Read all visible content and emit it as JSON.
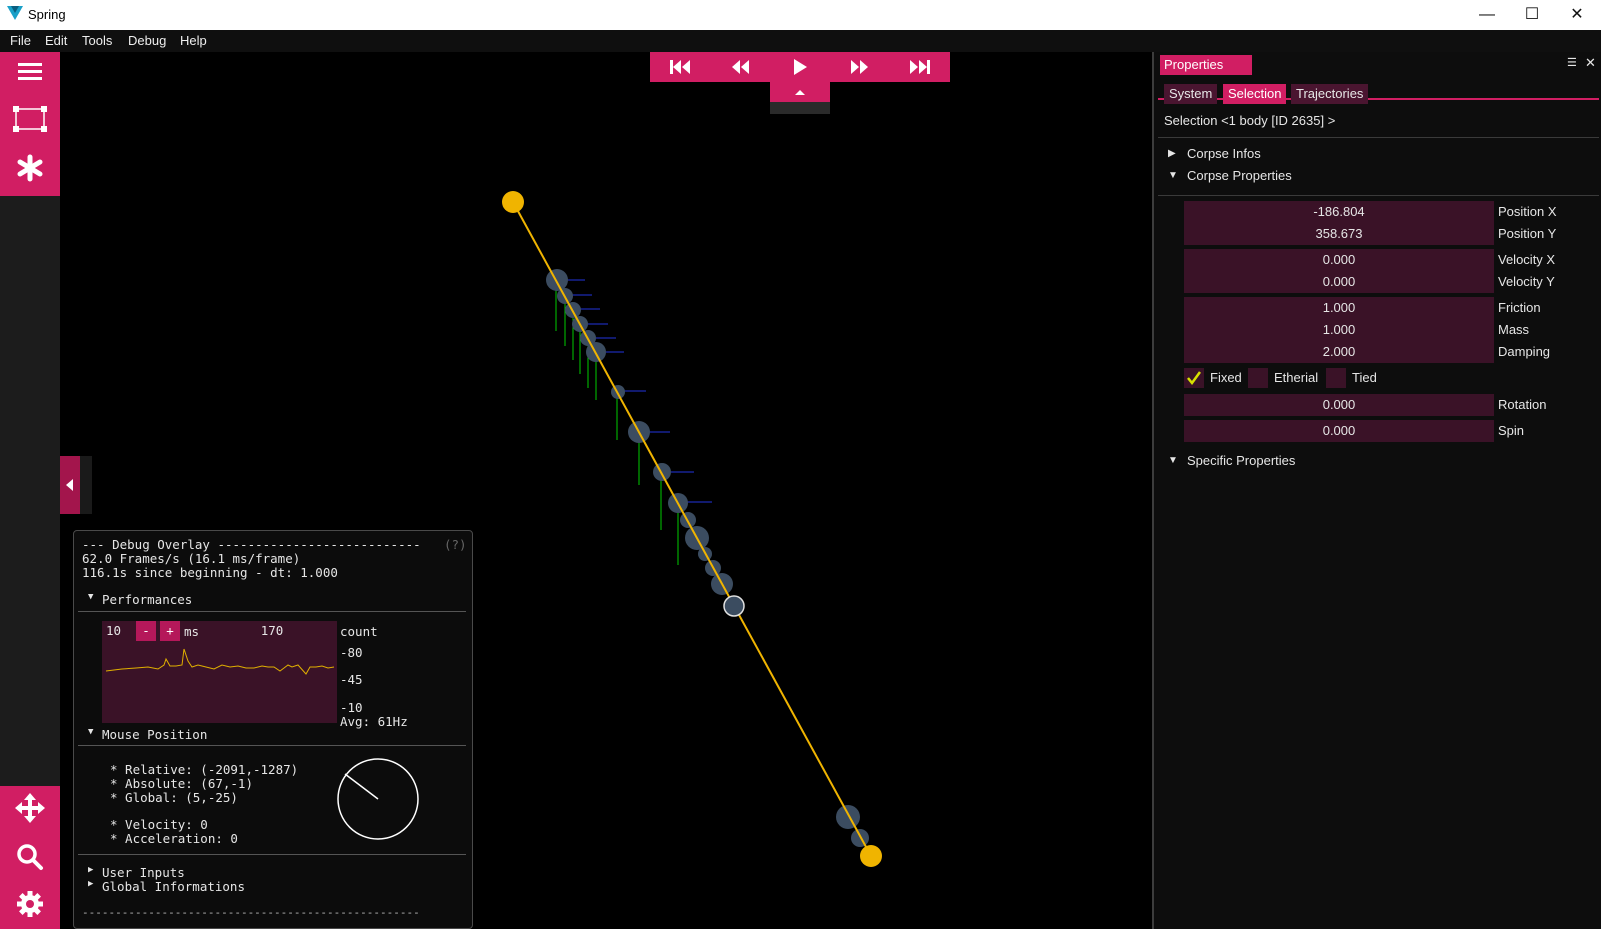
{
  "window": {
    "title": "Spring",
    "minimize": "—",
    "maximize": "☐",
    "close": "✕"
  },
  "menu": [
    "File",
    "Edit",
    "Tools",
    "Debug",
    "Help"
  ],
  "colors": {
    "accent": "#d11e63",
    "field": "#3a1227",
    "spring": "#f0b400",
    "body": "#3a4a5e",
    "force_green": "#00d000",
    "force_blue": "#2233dd"
  },
  "toolbox": {
    "top": [
      "hamburger-icon",
      "selection-rect-icon",
      "asterisk-icon"
    ],
    "bottom": [
      "move-icon",
      "search-icon",
      "gear-icon"
    ]
  },
  "playback": [
    "skip-start-icon",
    "rewind-icon",
    "play-icon",
    "fast-forward-icon",
    "skip-end-icon"
  ],
  "debug": {
    "header": "--- Debug Overlay ---------------------------",
    "help": "(?)",
    "fps": "62.0 Frames/s (16.1 ms/frame)",
    "since": "116.1s since beginning - dt: 1.000",
    "perf_title": "Performances",
    "ms_value": "10",
    "minus": "-",
    "plus": "+",
    "ms_unit": "ms",
    "count_value": "170",
    "count_label": "count",
    "axis_max": "-80",
    "axis_mid": "-45",
    "axis_min": "-10",
    "avg": "Avg: 61Hz",
    "mouse_title": "Mouse Position",
    "relative": "* Relative: (-2091,-1287)",
    "absolute": "* Absolute: (67,-1)",
    "global": "* Global: (5,-25)",
    "velocity": "* Velocity: 0",
    "acceleration": "* Acceleration: 0",
    "user_inputs": "User Inputs",
    "global_info": "Global Informations",
    "footer": "---------------------------------------------------"
  },
  "properties": {
    "tab": "Properties",
    "subtabs": [
      "System",
      "Selection",
      "Trajectories"
    ],
    "selection": "Selection <1 body [ID 2635] >",
    "corpse_infos": "Corpse Infos",
    "corpse_properties": "Corpse Properties",
    "position_x": {
      "value": "-186.804",
      "label": "Position X"
    },
    "position_y": {
      "value": "358.673",
      "label": "Position Y"
    },
    "velocity_x": {
      "value": "0.000",
      "label": "Velocity X"
    },
    "velocity_y": {
      "value": "0.000",
      "label": "Velocity Y"
    },
    "friction": {
      "value": "1.000",
      "label": "Friction"
    },
    "mass": {
      "value": "1.000",
      "label": "Mass"
    },
    "damping": {
      "value": "2.000",
      "label": "Damping"
    },
    "fixed": {
      "label": "Fixed",
      "checked": true
    },
    "etherial": {
      "label": "Etherial",
      "checked": false
    },
    "tied": {
      "label": "Tied",
      "checked": false
    },
    "rotation": {
      "value": "0.000",
      "label": "Rotation"
    },
    "spin": {
      "value": "0.000",
      "label": "Spin"
    },
    "specific": "Specific Properties"
  }
}
